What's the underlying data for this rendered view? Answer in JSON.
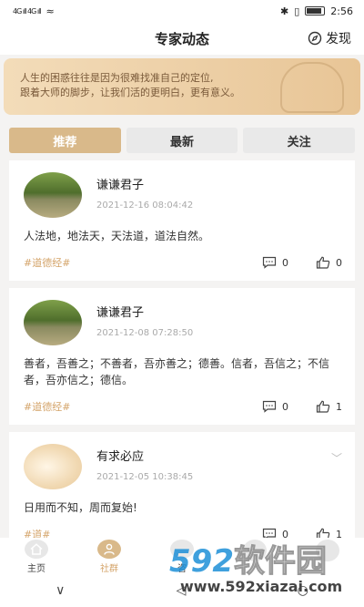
{
  "status_bar": {
    "signal_left": "4G ıll 4G ıll",
    "wifi": "≈",
    "time": "2:56"
  },
  "header": {
    "title": "专家动态",
    "discover_label": "发现"
  },
  "banner": {
    "line1": "人生的困惑往往是因为很难找准自己的定位,",
    "line2": "跟着大师的脚步，让我们活的更明白，更有意义。"
  },
  "tabs": [
    {
      "label": "推荐",
      "active": true
    },
    {
      "label": "最新",
      "active": false
    },
    {
      "label": "关注",
      "active": false
    }
  ],
  "posts": [
    {
      "name": "谦谦君子",
      "time": "2021-12-16 08:04:42",
      "content": "人法地，地法天，天法道，道法自然。",
      "tag": "#道德经#",
      "comments": "0",
      "likes": "0"
    },
    {
      "name": "谦谦君子",
      "time": "2021-12-08 07:28:50",
      "content": "善者，吾善之；不善者，吾亦善之；德善。信者，吾信之；不信者，吾亦信之；德信。",
      "tag": "#道德经#",
      "comments": "0",
      "likes": "1"
    },
    {
      "name": "有求必应",
      "time": "2021-12-05 10:38:45",
      "content": "日用而不知，周而复始!",
      "tag": "#道#",
      "comments": "0",
      "likes": "1"
    }
  ],
  "bottom_nav": [
    {
      "label": "主页",
      "icon": "home-icon"
    },
    {
      "label": "社群",
      "icon": "community-icon"
    },
    {
      "label": "咨",
      "icon": "consult-icon"
    },
    {
      "label": "",
      "icon": "message-icon"
    },
    {
      "label": "",
      "icon": "profile-icon"
    }
  ],
  "system_nav": {
    "back": "∨",
    "home": "◁",
    "recent": "○"
  },
  "watermark": {
    "brand_num": "592",
    "brand_cn": "软件园",
    "url": "www.592xiazai.com"
  },
  "colors": {
    "accent": "#d9b98a",
    "tag": "#d4a46a",
    "banner_text": "#7a5a3a",
    "watermark_blue": "#1e90d8"
  }
}
